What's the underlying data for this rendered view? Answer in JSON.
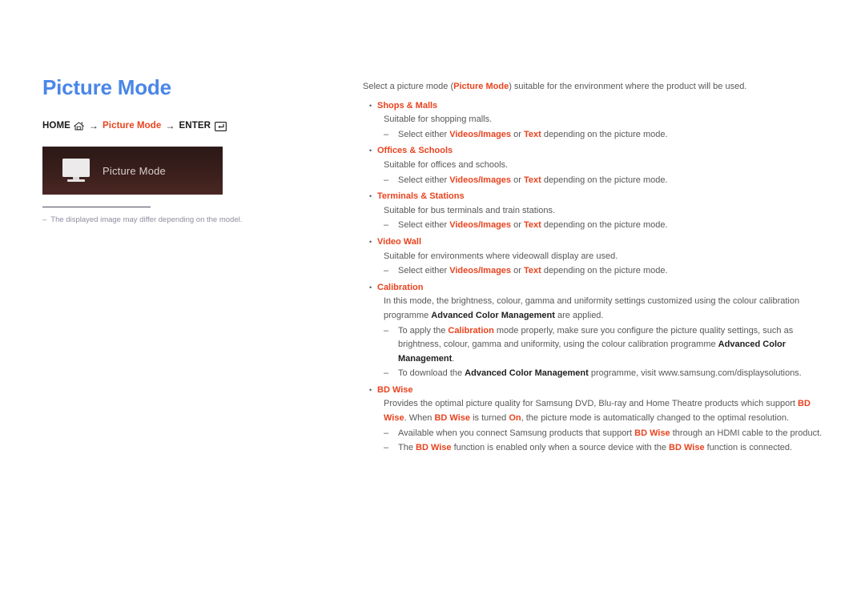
{
  "page": {
    "title": "Picture Mode",
    "title_color": "#4a86e8",
    "accent_color": "#e8431f",
    "body_color": "#58585a",
    "panel_color": "#3a1f1c"
  },
  "nav_path": {
    "home_label": "HOME",
    "home_icon": "home-icon",
    "arrow": "→",
    "middle_label": "Picture Mode",
    "enter_label": "ENTER",
    "enter_icon": "enter-key-icon"
  },
  "preview": {
    "icon": "monitor-icon",
    "label": "Picture Mode"
  },
  "left_note": {
    "dash": "–",
    "text": "The displayed image may differ depending on the model."
  },
  "content": {
    "intro": {
      "pre": "Select a picture mode (",
      "term": "Picture Mode",
      "post": ") suitable for the environment where the product will be used."
    },
    "bullet_glyph": "•",
    "dash_glyph": "–",
    "modes": [
      {
        "name": "Shops & Malls",
        "description": "Suitable for shopping malls.",
        "subitems": [
          {
            "pre": "Select either ",
            "term1": "Videos/Images",
            "mid": " or ",
            "term2": "Text",
            "post": " depending on the picture mode."
          }
        ]
      },
      {
        "name": "Offices & Schools",
        "description": "Suitable for offices and schools.",
        "subitems": [
          {
            "pre": "Select either ",
            "term1": "Videos/Images",
            "mid": " or ",
            "term2": "Text",
            "post": " depending on the picture mode."
          }
        ]
      },
      {
        "name": "Terminals & Stations",
        "description": "Suitable for bus terminals and train stations.",
        "subitems": [
          {
            "pre": "Select either ",
            "term1": "Videos/Images",
            "mid": " or ",
            "term2": "Text",
            "post": " depending on the picture mode."
          }
        ]
      },
      {
        "name": "Video Wall",
        "description": "Suitable for environments where videowall display are used.",
        "subitems": [
          {
            "pre": "Select either ",
            "term1": "Videos/Images",
            "mid": " or ",
            "term2": "Text",
            "post": " depending on the picture mode."
          }
        ]
      }
    ],
    "calibration": {
      "name": "Calibration",
      "desc_pre": "In this mode, the brightness, colour, gamma and uniformity settings customized using the colour calibration programme ",
      "desc_bold": "Advanced Color Management",
      "desc_post": " are applied.",
      "sub1_pre": "To apply the ",
      "sub1_term": "Calibration",
      "sub1_mid": " mode properly, make sure you configure the picture quality settings, such as brightness, colour, gamma and uniformity, using the colour calibration programme ",
      "sub1_bold": "Advanced Color Management",
      "sub1_post": ".",
      "sub2_pre": "To download the ",
      "sub2_bold": "Advanced Color Management",
      "sub2_post": " programme, visit www.samsung.com/displaysolutions."
    },
    "bdwise": {
      "name": "BD Wise",
      "desc_pre": "Provides the optimal picture quality for Samsung DVD, Blu-ray and Home Theatre products which support ",
      "desc_term1": "BD Wise",
      "desc_mid": ". When ",
      "desc_term2": "BD Wise",
      "desc_mid2": " is turned ",
      "desc_term3": "On",
      "desc_post": ", the picture mode is automatically changed to the optimal resolution.",
      "sub1_pre": "Available when you connect Samsung products that support ",
      "sub1_term": "BD Wise",
      "sub1_post": " through an HDMI cable to the product.",
      "sub2_pre": "The ",
      "sub2_term1": "BD Wise",
      "sub2_mid": " function is enabled only when a source device with the ",
      "sub2_term2": "BD Wise",
      "sub2_post": " function is connected."
    }
  }
}
